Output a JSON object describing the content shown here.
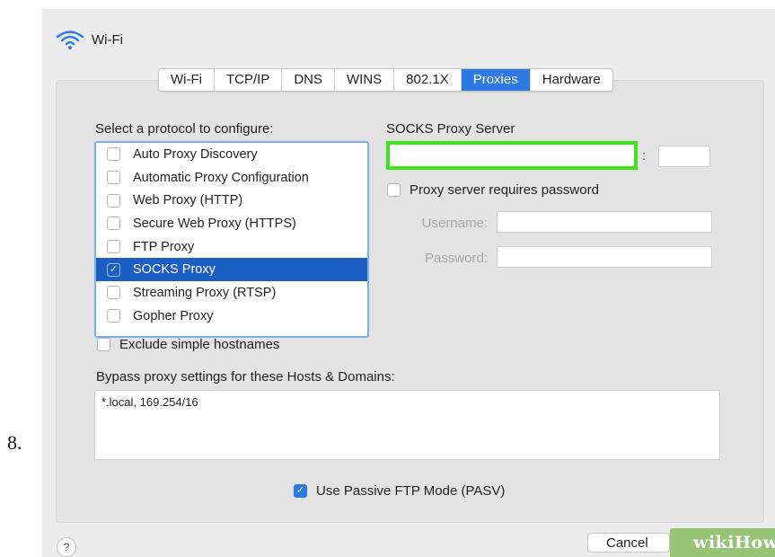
{
  "step_number": "8.",
  "header": {
    "title": "Wi-Fi",
    "icon": "wifi-icon"
  },
  "tabs": [
    {
      "label": "Wi-Fi",
      "active": false
    },
    {
      "label": "TCP/IP",
      "active": false
    },
    {
      "label": "DNS",
      "active": false
    },
    {
      "label": "WINS",
      "active": false
    },
    {
      "label": "802.1X",
      "active": false
    },
    {
      "label": "Proxies",
      "active": true
    },
    {
      "label": "Hardware",
      "active": false
    }
  ],
  "protocols": {
    "heading": "Select a protocol to configure:",
    "items": [
      {
        "label": "Auto Proxy Discovery",
        "checked": false,
        "selected": false
      },
      {
        "label": "Automatic Proxy Configuration",
        "checked": false,
        "selected": false
      },
      {
        "label": "Web Proxy (HTTP)",
        "checked": false,
        "selected": false
      },
      {
        "label": "Secure Web Proxy (HTTPS)",
        "checked": false,
        "selected": false
      },
      {
        "label": "FTP Proxy",
        "checked": false,
        "selected": false
      },
      {
        "label": "SOCKS Proxy",
        "checked": true,
        "selected": true
      },
      {
        "label": "Streaming Proxy (RTSP)",
        "checked": false,
        "selected": false
      },
      {
        "label": "Gopher Proxy",
        "checked": false,
        "selected": false
      }
    ]
  },
  "server": {
    "heading": "SOCKS Proxy Server",
    "address_value": "",
    "port_separator": ":",
    "port_value": "",
    "requires_password_label": "Proxy server requires password",
    "requires_password_checked": false,
    "username_label": "Username:",
    "username_value": "",
    "password_label": "Password:",
    "password_value": ""
  },
  "exclude_simple": {
    "label": "Exclude simple hostnames",
    "checked": false
  },
  "bypass": {
    "label": "Bypass proxy settings for these Hosts & Domains:",
    "value": "*.local, 169.254/16"
  },
  "passive_ftp": {
    "label": "Use Passive FTP Mode (PASV)",
    "checked": true
  },
  "footer": {
    "help_label": "?",
    "cancel_label": "Cancel",
    "watermark": "wikiHow"
  },
  "colors": {
    "accent": "#2d7ae5",
    "selection": "#1c5fc4",
    "highlight": "#3de61c"
  }
}
